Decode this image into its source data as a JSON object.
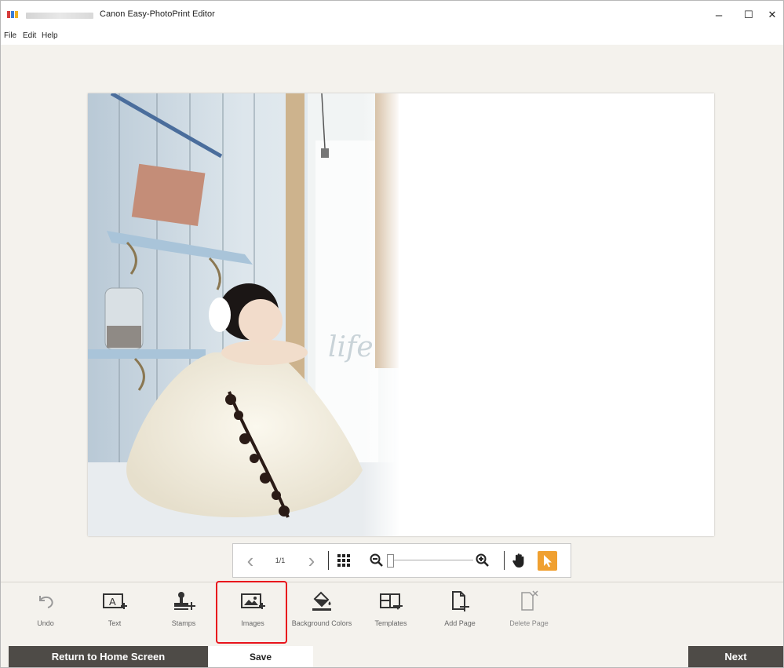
{
  "window": {
    "title": "Canon Easy-PhotoPrint Editor",
    "minimize": "–",
    "maximize": "☐",
    "close": "✕"
  },
  "menu": [
    "File",
    "Edit",
    "Help"
  ],
  "canvas": {
    "photo_text": "life"
  },
  "navigation": {
    "page_indicator": "1/1",
    "prev": "‹",
    "next": "›"
  },
  "toolbar": [
    {
      "label": "Undo",
      "icon": "undo-icon"
    },
    {
      "label": "Text",
      "icon": "text-icon"
    },
    {
      "label": "Stamps",
      "icon": "stamp-icon"
    },
    {
      "label": "Images",
      "icon": "image-add-icon"
    },
    {
      "label": "Background Colors",
      "icon": "paint-bucket-icon"
    },
    {
      "label": "Templates",
      "icon": "templates-icon"
    },
    {
      "label": "Add Page",
      "icon": "add-page-icon"
    },
    {
      "label": "Delete Page",
      "icon": "delete-page-icon"
    }
  ],
  "bottom": {
    "home": "Return to Home Screen",
    "save": "Save",
    "next": "Next"
  },
  "colors": {
    "accent": "#f0a030",
    "dark_button": "#4e4b47",
    "highlight": "#e8141c"
  }
}
